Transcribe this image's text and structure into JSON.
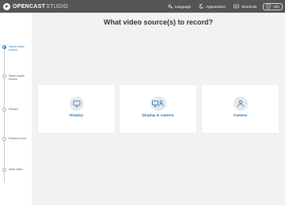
{
  "app": {
    "logo_text": "OPENCAST",
    "logo_subtext": "STUDIO"
  },
  "header": {
    "language_label": "Language",
    "appearance_label": "Appearance",
    "shortcuts_label": "Shortcuts",
    "info_label": "Info"
  },
  "steps": [
    {
      "label": "Select video source",
      "active": true
    },
    {
      "label": "Select audio source",
      "active": false
    },
    {
      "label": "Record",
      "active": false
    },
    {
      "label": "Review & trim",
      "active": false
    },
    {
      "label": "Save video",
      "active": false
    }
  ],
  "main": {
    "title": "What video source(s) to record?"
  },
  "sources": [
    {
      "label": "Display",
      "icon": "display-icon"
    },
    {
      "label": "Display & camera",
      "icon": "display-camera-icon"
    },
    {
      "label": "Camera",
      "icon": "camera-user-icon"
    }
  ],
  "colors": {
    "header_bg": "#555555",
    "accent": "#2773b2",
    "page_bg": "#f2f2f2"
  }
}
